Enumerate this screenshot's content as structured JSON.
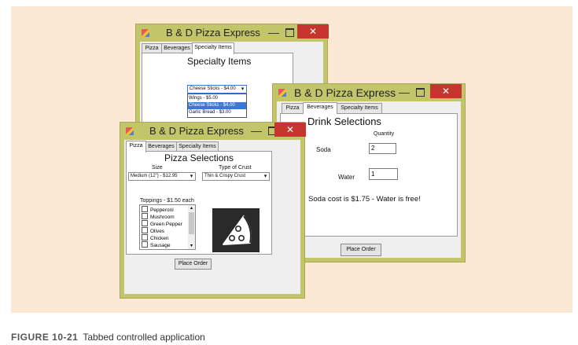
{
  "caption": {
    "label": "FIGURE 10-21",
    "text": "Tabbed controlled application"
  },
  "specialty_window": {
    "title": "B & D Pizza Express",
    "tabs": [
      "Pizza",
      "Beverages",
      "Specialty Items"
    ],
    "heading": "Specialty Items",
    "combo_value": "Cheese Sticks - $4.00",
    "dropdown_options": [
      "Wings - $5.00",
      "Cheese Sticks - $4.00",
      "Garlic Bread - $3.00"
    ],
    "selected_option_index": 1
  },
  "beverages_window": {
    "title": "B & D Pizza Express",
    "tabs": [
      "Pizza",
      "Beverages",
      "Specialty Items"
    ],
    "heading": "Drink Selections",
    "quantity_label": "Quantity",
    "soda_label": "Soda",
    "soda_value": "2",
    "water_label": "Water",
    "water_value": "1",
    "message": "Soda cost is $1.75 - Water is free!",
    "place_order_label": "Place Order"
  },
  "pizza_window": {
    "title": "B & D Pizza Express",
    "tabs": [
      "Pizza",
      "Beverages",
      "Specialty Items"
    ],
    "heading": "Pizza Selections",
    "size_label": "Size",
    "size_value": "Medium (12\") - $12.95",
    "crust_label": "Type of Crust",
    "crust_value": "Thin & Crispy Crust",
    "toppings_label": "Toppings - $1.50 each",
    "toppings": [
      "Pepperoni",
      "Mushroom",
      "Green Pepper",
      "Olives",
      "Chicken",
      "Sausage"
    ],
    "place_order_label": "Place Order"
  },
  "colors": {
    "frame": "#c3c56a",
    "close_button": "#c6362e",
    "background_panel": "#fbe9d6",
    "selection": "#3a78d8",
    "logo_background": "#2a2a2a"
  },
  "icons": [
    "app-icon",
    "minimize-icon",
    "maximize-icon",
    "close-icon",
    "chevron-down-icon",
    "pizza-slice-icon"
  ]
}
